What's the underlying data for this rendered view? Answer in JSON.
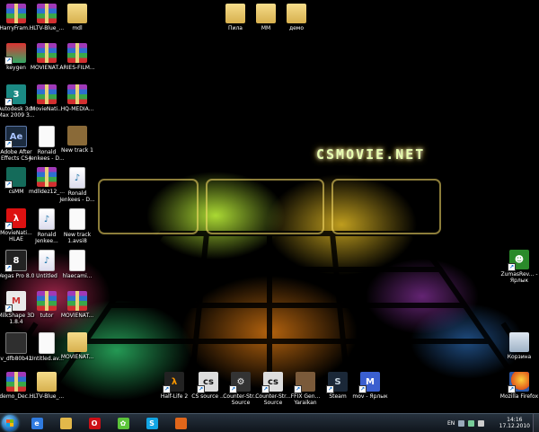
{
  "wallpaper": {
    "logo_text": "CSMOVIE.NET"
  },
  "desktop_icons": [
    {
      "label": "HarryFram...",
      "kind": "rar",
      "glyph": ""
    },
    {
      "label": "HLTV-Blue_...",
      "kind": "rar",
      "glyph": ""
    },
    {
      "label": "mdl",
      "kind": "folder",
      "glyph": ""
    },
    {
      "label": "keygen",
      "kind": "keygen",
      "glyph": ""
    },
    {
      "label": "MOVIENAT...",
      "kind": "rar",
      "glyph": ""
    },
    {
      "label": "ARIES-FILM...",
      "kind": "rar",
      "glyph": ""
    },
    {
      "label": "Autodesk 3ds Max 2009 3...",
      "kind": "3ds",
      "glyph": "3"
    },
    {
      "label": "MovieNati...",
      "kind": "rar",
      "glyph": ""
    },
    {
      "label": "HQ-MEDIA...",
      "kind": "rar",
      "glyph": ""
    },
    {
      "label": "Adobe After Effects CS4",
      "kind": "ae",
      "glyph": "Ae"
    },
    {
      "label": "Ronald Jenkees - D...",
      "kind": "file",
      "glyph": ""
    },
    {
      "label": "New track 1",
      "kind": "box",
      "glyph": ""
    },
    {
      "label": "csMM",
      "kind": "csmm",
      "glyph": ""
    },
    {
      "label": "mdlldez12_...",
      "kind": "rar",
      "glyph": ""
    },
    {
      "label": "Ronald Jenkees - D...",
      "kind": "media",
      "glyph": "♪"
    },
    {
      "label": "MovieNati... HLAE",
      "kind": "hlae",
      "glyph": "λ"
    },
    {
      "label": "Ronald Jenkee...",
      "kind": "media",
      "glyph": "♪"
    },
    {
      "label": "New track 1.avsi8",
      "kind": "file",
      "glyph": ""
    },
    {
      "label": "Vegas Pro 8.0",
      "kind": "vegas",
      "glyph": "8"
    },
    {
      "label": "Untitled",
      "kind": "media",
      "glyph": "♪"
    },
    {
      "label": "hlaecami...",
      "kind": "file",
      "glyph": ""
    },
    {
      "label": "MilkShape 3D 1.8.4",
      "kind": "milk",
      "glyph": "M"
    },
    {
      "label": "tutor",
      "kind": "rar",
      "glyph": ""
    },
    {
      "label": "MOVIENAT...",
      "kind": "rar",
      "glyph": ""
    },
    {
      "label": "v_dfb80b42",
      "kind": "x",
      "glyph": ""
    },
    {
      "label": "Untitled.av...",
      "kind": "file",
      "glyph": ""
    },
    {
      "label": "MOVIENAT...",
      "kind": "folder",
      "glyph": ""
    },
    {
      "label": "demo_Dec...",
      "kind": "rar",
      "glyph": ""
    },
    {
      "label": "HLTV-Blue_...",
      "kind": "folder",
      "glyph": ""
    }
  ],
  "top_folders": [
    "Пила",
    "ММ",
    "демо"
  ],
  "right_icons": [
    {
      "label": "ZumasRev... - Ярлык",
      "kind": "zuma",
      "glyph": "☻"
    },
    {
      "label": "Корзина",
      "kind": "bin",
      "glyph": ""
    },
    {
      "label": "Mozilla Firefox",
      "kind": "ff",
      "glyph": ""
    }
  ],
  "bottom_shortcuts": [
    {
      "label": "Half-Life 2",
      "kind": "hl",
      "glyph": "λ"
    },
    {
      "label": "CS source ...",
      "kind": "cs",
      "glyph": "cs"
    },
    {
      "label": "Counter-Str... Source",
      "kind": "sw",
      "glyph": "⚙"
    },
    {
      "label": "Counter-Str... Source",
      "kind": "cs",
      "glyph": "cs"
    },
    {
      "label": "FFIX Gen... Yaraikan",
      "kind": "man",
      "glyph": ""
    },
    {
      "label": "Steam",
      "kind": "steam",
      "glyph": "S"
    },
    {
      "label": "mov - Ярлык",
      "kind": "mov",
      "glyph": "M"
    }
  ],
  "taskbar": {
    "apps": [
      {
        "name": "internet-explorer",
        "color": "#2f7be0",
        "glyph": "e"
      },
      {
        "name": "explorer",
        "color": "#e2b84a",
        "glyph": ""
      },
      {
        "name": "opera",
        "color": "#cc0f16",
        "glyph": "O"
      },
      {
        "name": "icq",
        "color": "#5cc43a",
        "glyph": "✿"
      },
      {
        "name": "skype",
        "color": "#12a5e4",
        "glyph": "S"
      },
      {
        "name": "firefox",
        "color": "#e0661a",
        "glyph": ""
      }
    ],
    "language": "EN",
    "time": "14:16",
    "date": "17.12.2010"
  }
}
